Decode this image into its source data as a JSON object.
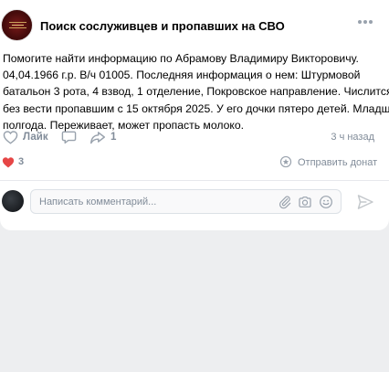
{
  "post": {
    "group_name": "Поиск сослуживцев и пропавших на СВО",
    "text_lines": [
      "Помогите найти информацию по Абрамову Владимиру Викторовичу.",
      "04,04.1966 г.р. В/ч 01005. Последняя информация о нем: Штурмовой",
      "батальон 3 рота, 4 взвод, 1 отделение, Покровское направление. Числится",
      "без вести пропавшим с 15 октября 2025. У его дочки пятеро детей. Младшей",
      "полгода. Переживает, может пропасть молоко."
    ],
    "time_ago": "3 ч назад"
  },
  "actions": {
    "like_label": "Лайк",
    "share_count": "1"
  },
  "reactions": {
    "count": "3",
    "donate_label": "Отправить донат"
  },
  "comment": {
    "placeholder": "Написать комментарий..."
  },
  "icons": {
    "more": "more-horizontal-icon",
    "like": "heart-outline-icon",
    "comment": "comment-bubble-icon",
    "share": "share-arrow-icon",
    "reaction": "heart-filled-icon",
    "donate": "donate-icon",
    "attach": "paperclip-icon",
    "camera": "camera-icon",
    "emoji": "smile-icon",
    "send": "send-icon"
  },
  "colors": {
    "background": "#edeef0",
    "card": "#ffffff",
    "secondary_text": "#818c99",
    "icon": "#99a2ad",
    "reaction_heart": "#e64646"
  }
}
